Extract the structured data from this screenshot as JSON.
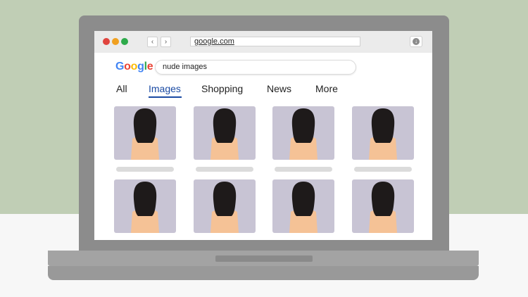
{
  "browser": {
    "back_glyph": "‹",
    "forward_glyph": "›",
    "address": "google.com",
    "download_glyph": "↓"
  },
  "logo": {
    "letters": [
      "G",
      "o",
      "o",
      "g",
      "l",
      "e"
    ],
    "colors": [
      "#4285f4",
      "#ea4335",
      "#fbbc05",
      "#4285f4",
      "#34a853",
      "#ea4335"
    ]
  },
  "search": {
    "query": "nude images"
  },
  "tabs": [
    {
      "label": "All"
    },
    {
      "label": "Images",
      "active": true
    },
    {
      "label": "Shopping"
    },
    {
      "label": "News"
    },
    {
      "label": "More"
    }
  ],
  "results_count": 8,
  "colors": {
    "traffic_red": "#e0443e",
    "traffic_yellow": "#f0a020",
    "traffic_green": "#2daa4a",
    "thumb_bg": "#c8c4d4",
    "hair": "#1e1a1a",
    "skin": "#f5c296"
  }
}
